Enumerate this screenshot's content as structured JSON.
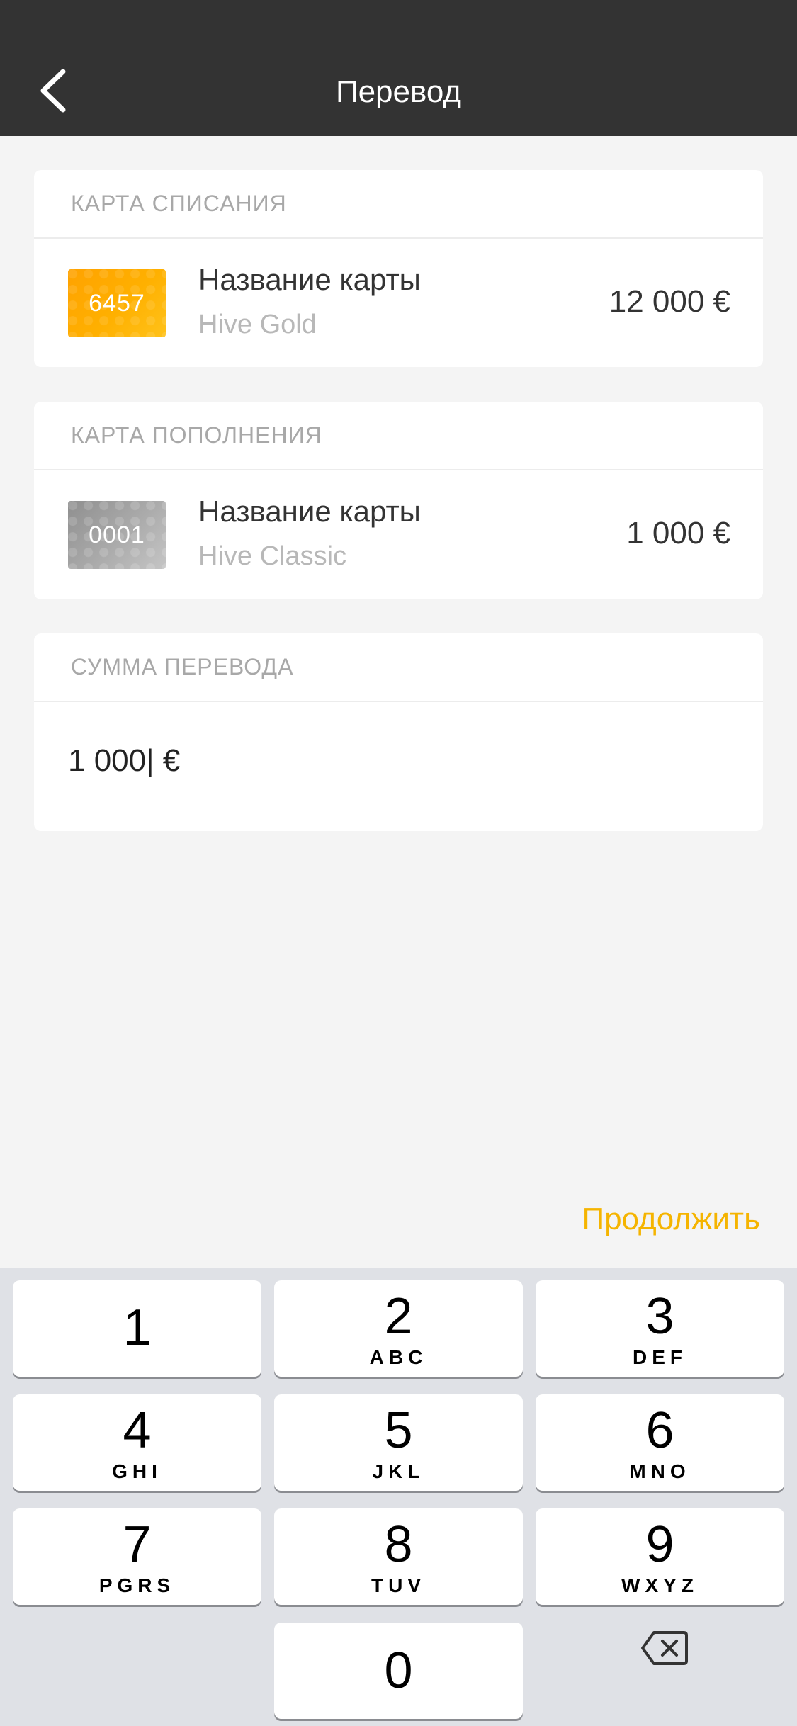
{
  "header": {
    "title": "Перевод"
  },
  "debit": {
    "section": "КАРТА СПИСАНИЯ",
    "card_number": "6457",
    "name": "Название карты",
    "product": "Hive Gold",
    "balance": "12 000 €"
  },
  "credit": {
    "section": "КАРТА ПОПОЛНЕНИЯ",
    "card_number": "0001",
    "name": "Название карты",
    "product": "Hive Classic",
    "balance": "1 000 €"
  },
  "amount": {
    "section": "СУММА ПЕРЕВОДА",
    "value": "1 000| €"
  },
  "continue_label": "Продолжить",
  "keypad": {
    "keys": [
      {
        "digit": "1",
        "letters": ""
      },
      {
        "digit": "2",
        "letters": "ABC"
      },
      {
        "digit": "3",
        "letters": "DEF"
      },
      {
        "digit": "4",
        "letters": "GHI"
      },
      {
        "digit": "5",
        "letters": "JKL"
      },
      {
        "digit": "6",
        "letters": "MNO"
      },
      {
        "digit": "7",
        "letters": "PGRS"
      },
      {
        "digit": "8",
        "letters": "TUV"
      },
      {
        "digit": "9",
        "letters": "WXYZ"
      },
      {
        "digit": "0",
        "letters": ""
      }
    ]
  },
  "colors": {
    "header_bg": "#333333",
    "accent": "#f5b400",
    "keypad_bg": "#dfe1e6"
  },
  "icons": {
    "back": "chevron-left-icon",
    "delete": "backspace-icon"
  }
}
